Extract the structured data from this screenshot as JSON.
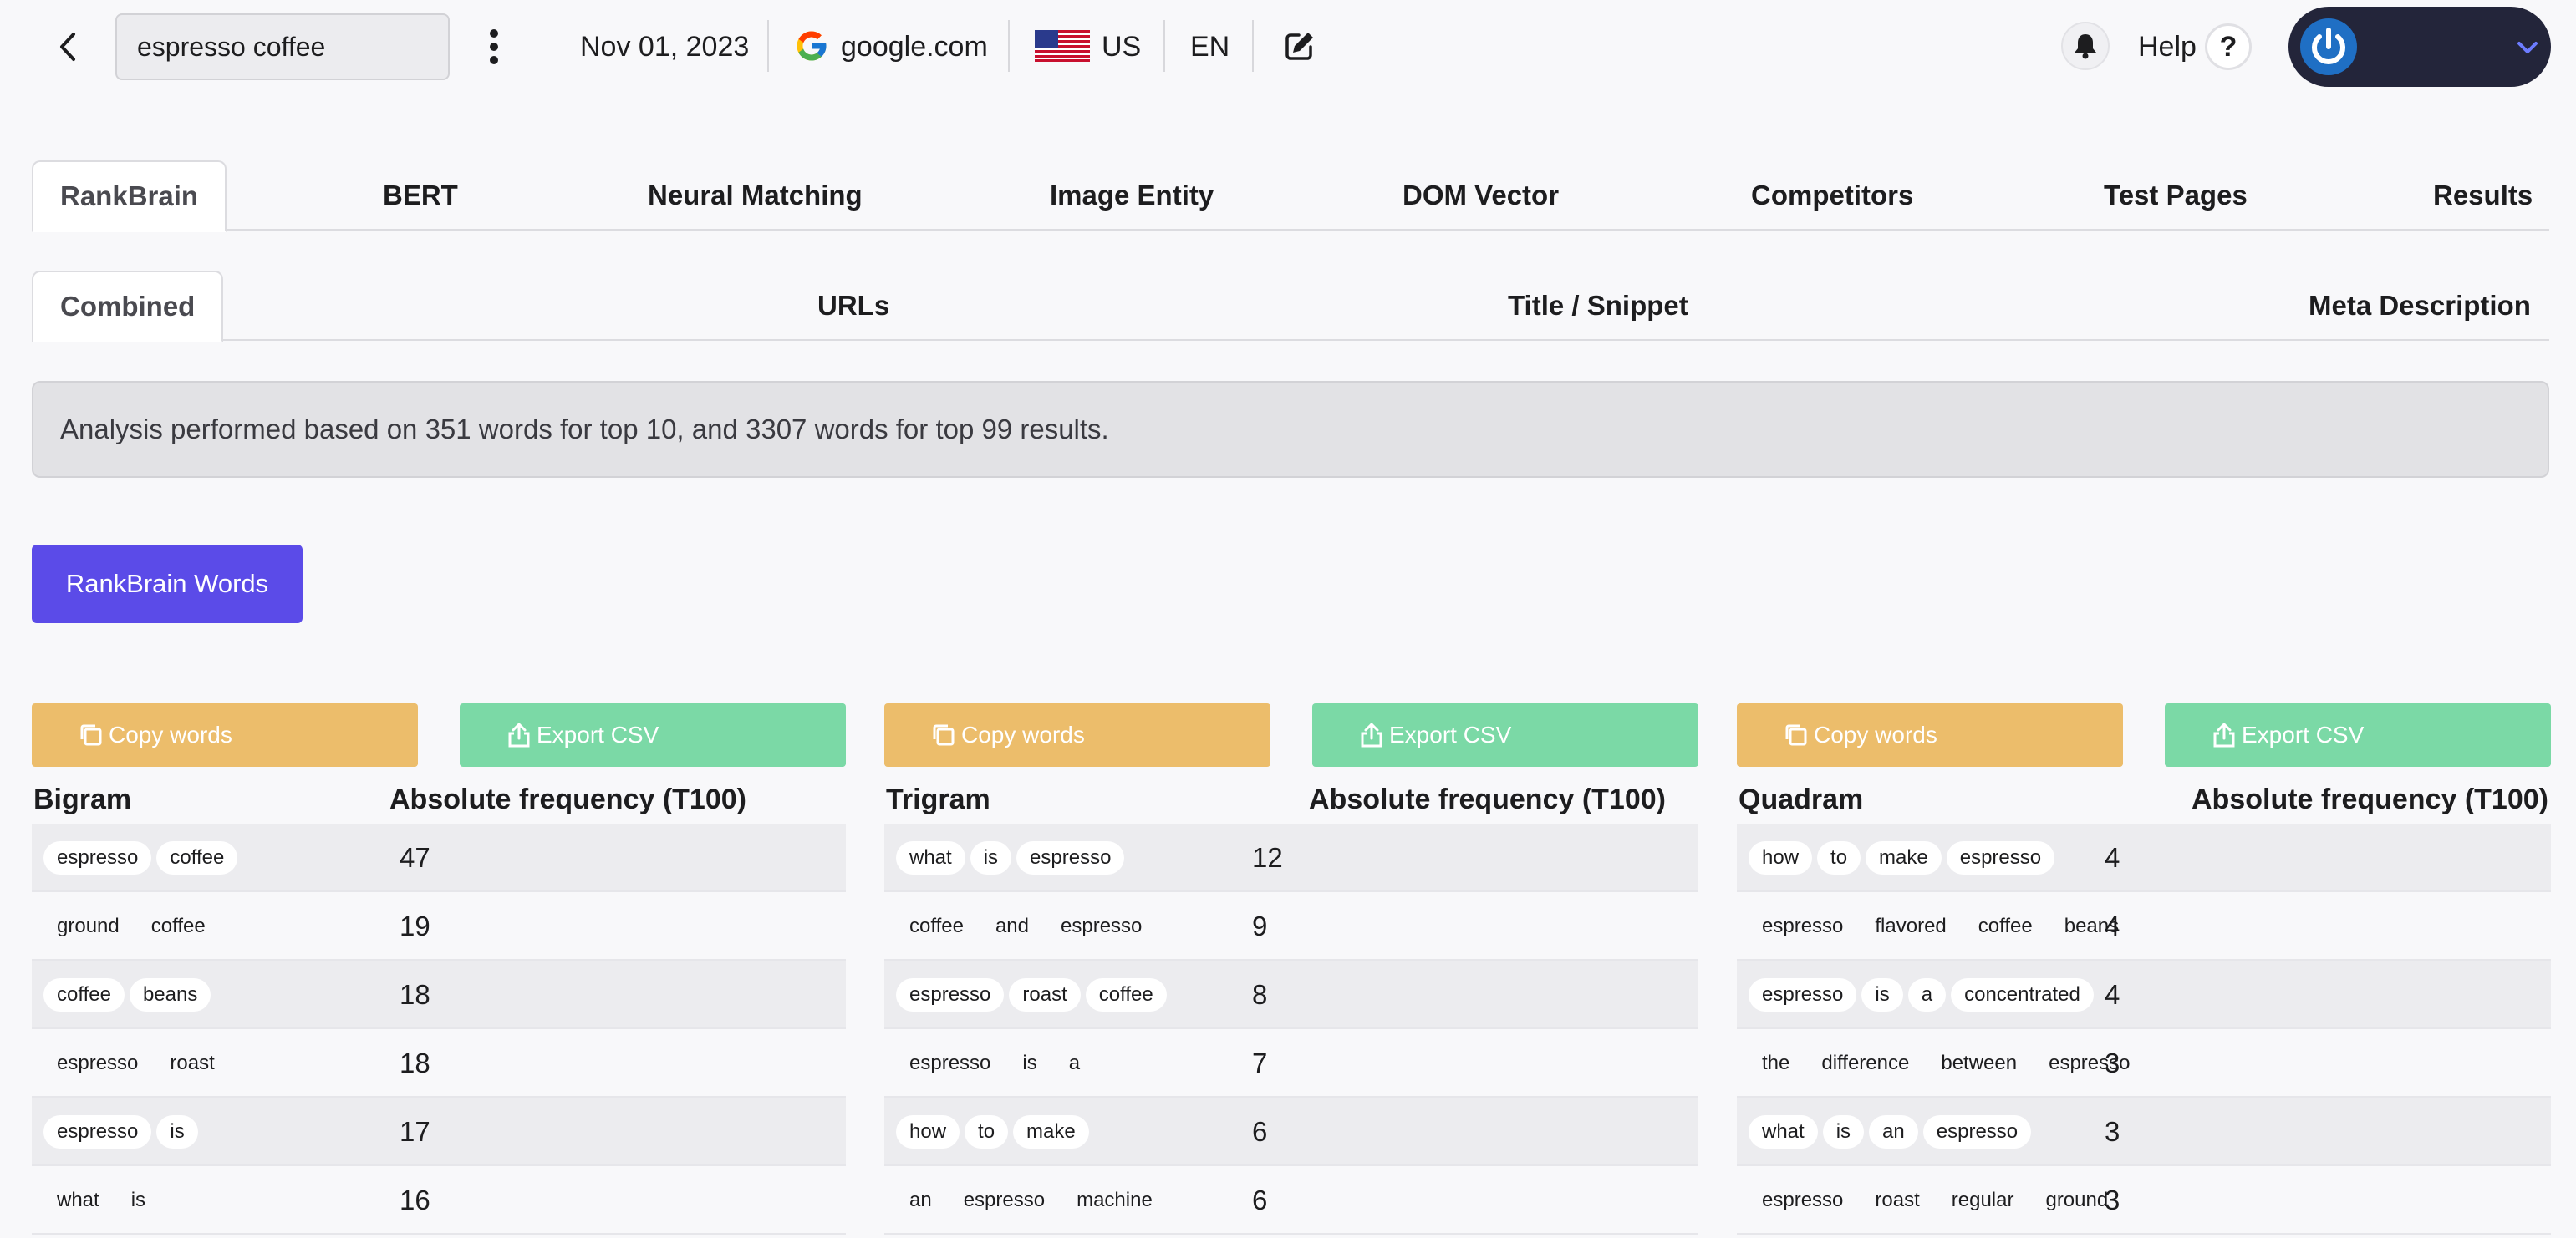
{
  "topbar": {
    "search_value": "espresso coffee",
    "date": "Nov 01, 2023",
    "engine": "google.com",
    "country": "US",
    "language": "EN",
    "help_label": "Help",
    "help_symbol": "?"
  },
  "tabs_primary": [
    "RankBrain",
    "BERT",
    "Neural Matching",
    "Image Entity",
    "DOM Vector",
    "Competitors",
    "Test Pages",
    "Results"
  ],
  "tabs_secondary": [
    "Combined",
    "URLs",
    "Title / Snippet",
    "Meta Description"
  ],
  "info_banner": "Analysis performed based on 351 words for top 10, and 3307 words for top 99 results.",
  "rankbrain_button": "RankBrain Words",
  "colors": {
    "accent": "#5b4be8",
    "copy": "#ecbd6b",
    "export": "#7bd9a6",
    "account_bg": "#23253a",
    "power_blue": "#1f6fc4"
  },
  "panels": [
    {
      "copy_label": "Copy words",
      "export_label": "Export CSV",
      "col1": "Bigram",
      "col2": "Absolute frequency (T100)",
      "rows": [
        {
          "words": [
            "espresso",
            "coffee"
          ],
          "freq": "47"
        },
        {
          "words": [
            "ground",
            "coffee"
          ],
          "freq": "19"
        },
        {
          "words": [
            "coffee",
            "beans"
          ],
          "freq": "18"
        },
        {
          "words": [
            "espresso",
            "roast"
          ],
          "freq": "18"
        },
        {
          "words": [
            "espresso",
            "is"
          ],
          "freq": "17"
        },
        {
          "words": [
            "what",
            "is"
          ],
          "freq": "16"
        }
      ]
    },
    {
      "copy_label": "Copy words",
      "export_label": "Export CSV",
      "col1": "Trigram",
      "col2": "Absolute frequency (T100)",
      "rows": [
        {
          "words": [
            "what",
            "is",
            "espresso"
          ],
          "freq": "12"
        },
        {
          "words": [
            "coffee",
            "and",
            "espresso"
          ],
          "freq": "9"
        },
        {
          "words": [
            "espresso",
            "roast",
            "coffee"
          ],
          "freq": "8"
        },
        {
          "words": [
            "espresso",
            "is",
            "a"
          ],
          "freq": "7"
        },
        {
          "words": [
            "how",
            "to",
            "make"
          ],
          "freq": "6"
        },
        {
          "words": [
            "an",
            "espresso",
            "machine"
          ],
          "freq": "6"
        }
      ]
    },
    {
      "copy_label": "Copy words",
      "export_label": "Export CSV",
      "col1": "Quadram",
      "col2": "Absolute frequency (T100)",
      "rows": [
        {
          "words": [
            "how",
            "to",
            "make",
            "espresso"
          ],
          "freq": "4"
        },
        {
          "words": [
            "espresso",
            "flavored",
            "coffee",
            "beans"
          ],
          "freq": "4"
        },
        {
          "words": [
            "espresso",
            "is",
            "a",
            "concentrated"
          ],
          "freq": "4"
        },
        {
          "words": [
            "the",
            "difference",
            "between",
            "espresso"
          ],
          "freq": "3"
        },
        {
          "words": [
            "what",
            "is",
            "an",
            "espresso"
          ],
          "freq": "3"
        },
        {
          "words": [
            "espresso",
            "roast",
            "regular",
            "ground"
          ],
          "freq": "3"
        }
      ]
    }
  ]
}
